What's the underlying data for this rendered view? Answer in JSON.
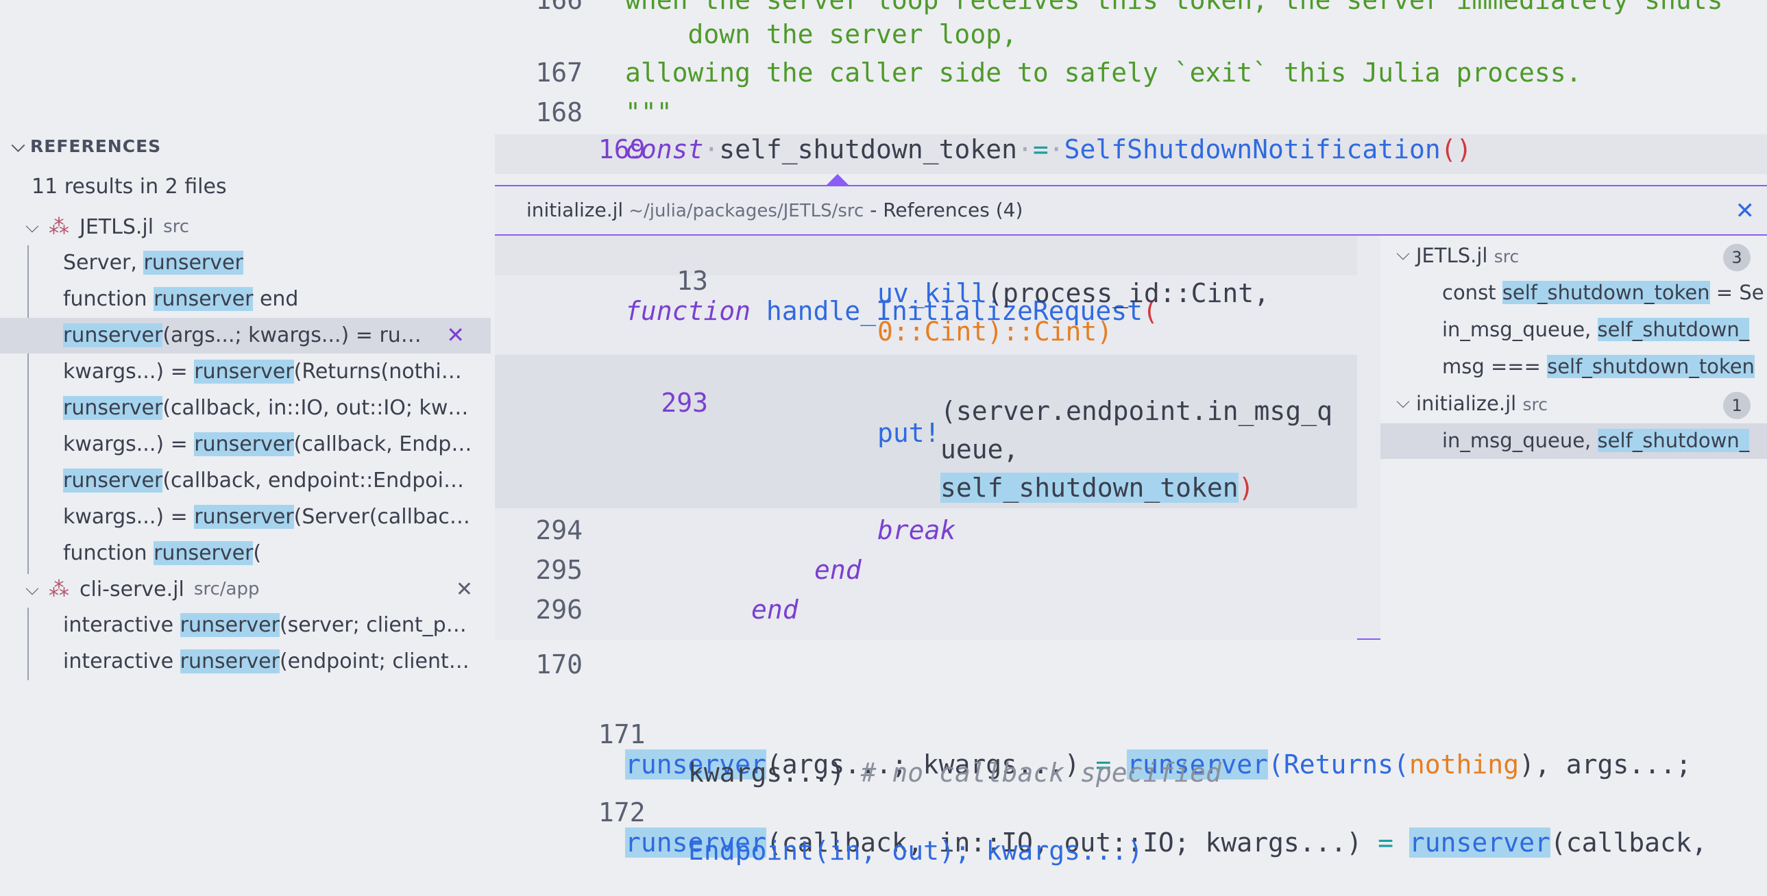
{
  "references": {
    "header": "REFERENCES",
    "summary": "11 results in 2 files",
    "files": [
      {
        "name": "JETLS.jl",
        "path": "src"
      },
      {
        "name": "cli-serve.jl",
        "path": "src/app"
      }
    ],
    "results": [
      {
        "pre": "Server, ",
        "hit": "runserver",
        "post": ""
      },
      {
        "pre": "function ",
        "hit": "runserver",
        "post": " end"
      },
      {
        "pre": "",
        "hit": "runserver",
        "post": "(args...; kwargs...) = runse..."
      },
      {
        "pre": "kwargs...) = ",
        "hit": "runserver",
        "post": "(Returns(nothing..."
      },
      {
        "pre": "",
        "hit": "runserver",
        "post": "(callback, in::IO, out::IO; kwar..."
      },
      {
        "pre": "kwargs...) = ",
        "hit": "runserver",
        "post": "(callback, Endpoi..."
      },
      {
        "pre": "",
        "hit": "runserver",
        "post": "(callback, endpoint::Endpoint;..."
      },
      {
        "pre": "kwargs...) = ",
        "hit": "runserver",
        "post": "(Server(callback,..."
      },
      {
        "pre": "function ",
        "hit": "runserver",
        "post": "("
      },
      {
        "pre": "interactive ",
        "hit": "runserver",
        "post": "(server; client_pro..."
      },
      {
        "pre": "interactive ",
        "hit": "runserver",
        "post": "(endpoint; client_..."
      }
    ]
  },
  "editor": {
    "top_lines": [
      {
        "num": "166",
        "text": "when the server loop receives this token, the server immediately shuts"
      },
      {
        "num": "",
        "text": "    down the server loop,"
      },
      {
        "num": "167",
        "text": "allowing the caller side to safely `exit` this Julia process."
      },
      {
        "num": "168",
        "text": "\"\"\""
      }
    ],
    "line169_num": "169",
    "line169": {
      "kw": "const",
      "var": "self_shutdown_token",
      "op": "=",
      "fn": "SelfShutdownNotification",
      "paren": "()"
    },
    "bottom_lines": [
      {
        "num": "170"
      },
      {
        "num": "171"
      },
      {
        "num": "172"
      }
    ],
    "line171": {
      "hit1": "runserver",
      "a": "(args...; kwargs...)",
      "eq": " = ",
      "hit2": "runserver",
      "b": "(Returns(",
      "nothing": "nothing",
      "c": "), args...;",
      "cont": "kwargs...)",
      "comment": "# no callback specified"
    },
    "line172": {
      "hit1": "runserver",
      "a": "(callback, in::IO, out::IO; kwargs...)",
      "eq": " = ",
      "hit2": "runserver",
      "b": "(callback,",
      "cont": "Endpoint(in, out); kwargs...)"
    }
  },
  "peek": {
    "file": "initialize.jl",
    "path": "~/julia/packages/JETLS/src",
    "label": "- References (4)",
    "code": {
      "l13_num": "13",
      "l13_kw": "function",
      "l13_fn": "handle_InitializeRequest",
      "l13_paren": "(",
      "uvkill": "uv_kill",
      "uvkill_args": "(process_id::Cint,",
      "uvkill_args2": "0::Cint)::Cint)",
      "l293_num": "293",
      "put": "put!",
      "put_args1": "(server.endpoint.in_msg_q",
      "put_args2": "ueue,",
      "put_args3": "self_shutdown_token",
      "l294_num": "294",
      "break": "break",
      "l295_num": "295",
      "end1": "end",
      "l296_num": "296",
      "end2": "end"
    },
    "refs": [
      {
        "name": "JETLS.jl",
        "path": "src",
        "count": "3"
      },
      {
        "pre": "const ",
        "hit": "self_shutdown_token",
        "post": " = Se"
      },
      {
        "pre": "in_msg_queue, ",
        "hit": "self_shutdown_",
        "post": ""
      },
      {
        "pre": "msg === ",
        "hit": "self_shutdown_token",
        "post": ""
      },
      {
        "name": "initialize.jl",
        "path": "src",
        "count": "1"
      },
      {
        "pre": "in_msg_queue, ",
        "hit": "self_shutdown_",
        "post": ""
      }
    ]
  }
}
